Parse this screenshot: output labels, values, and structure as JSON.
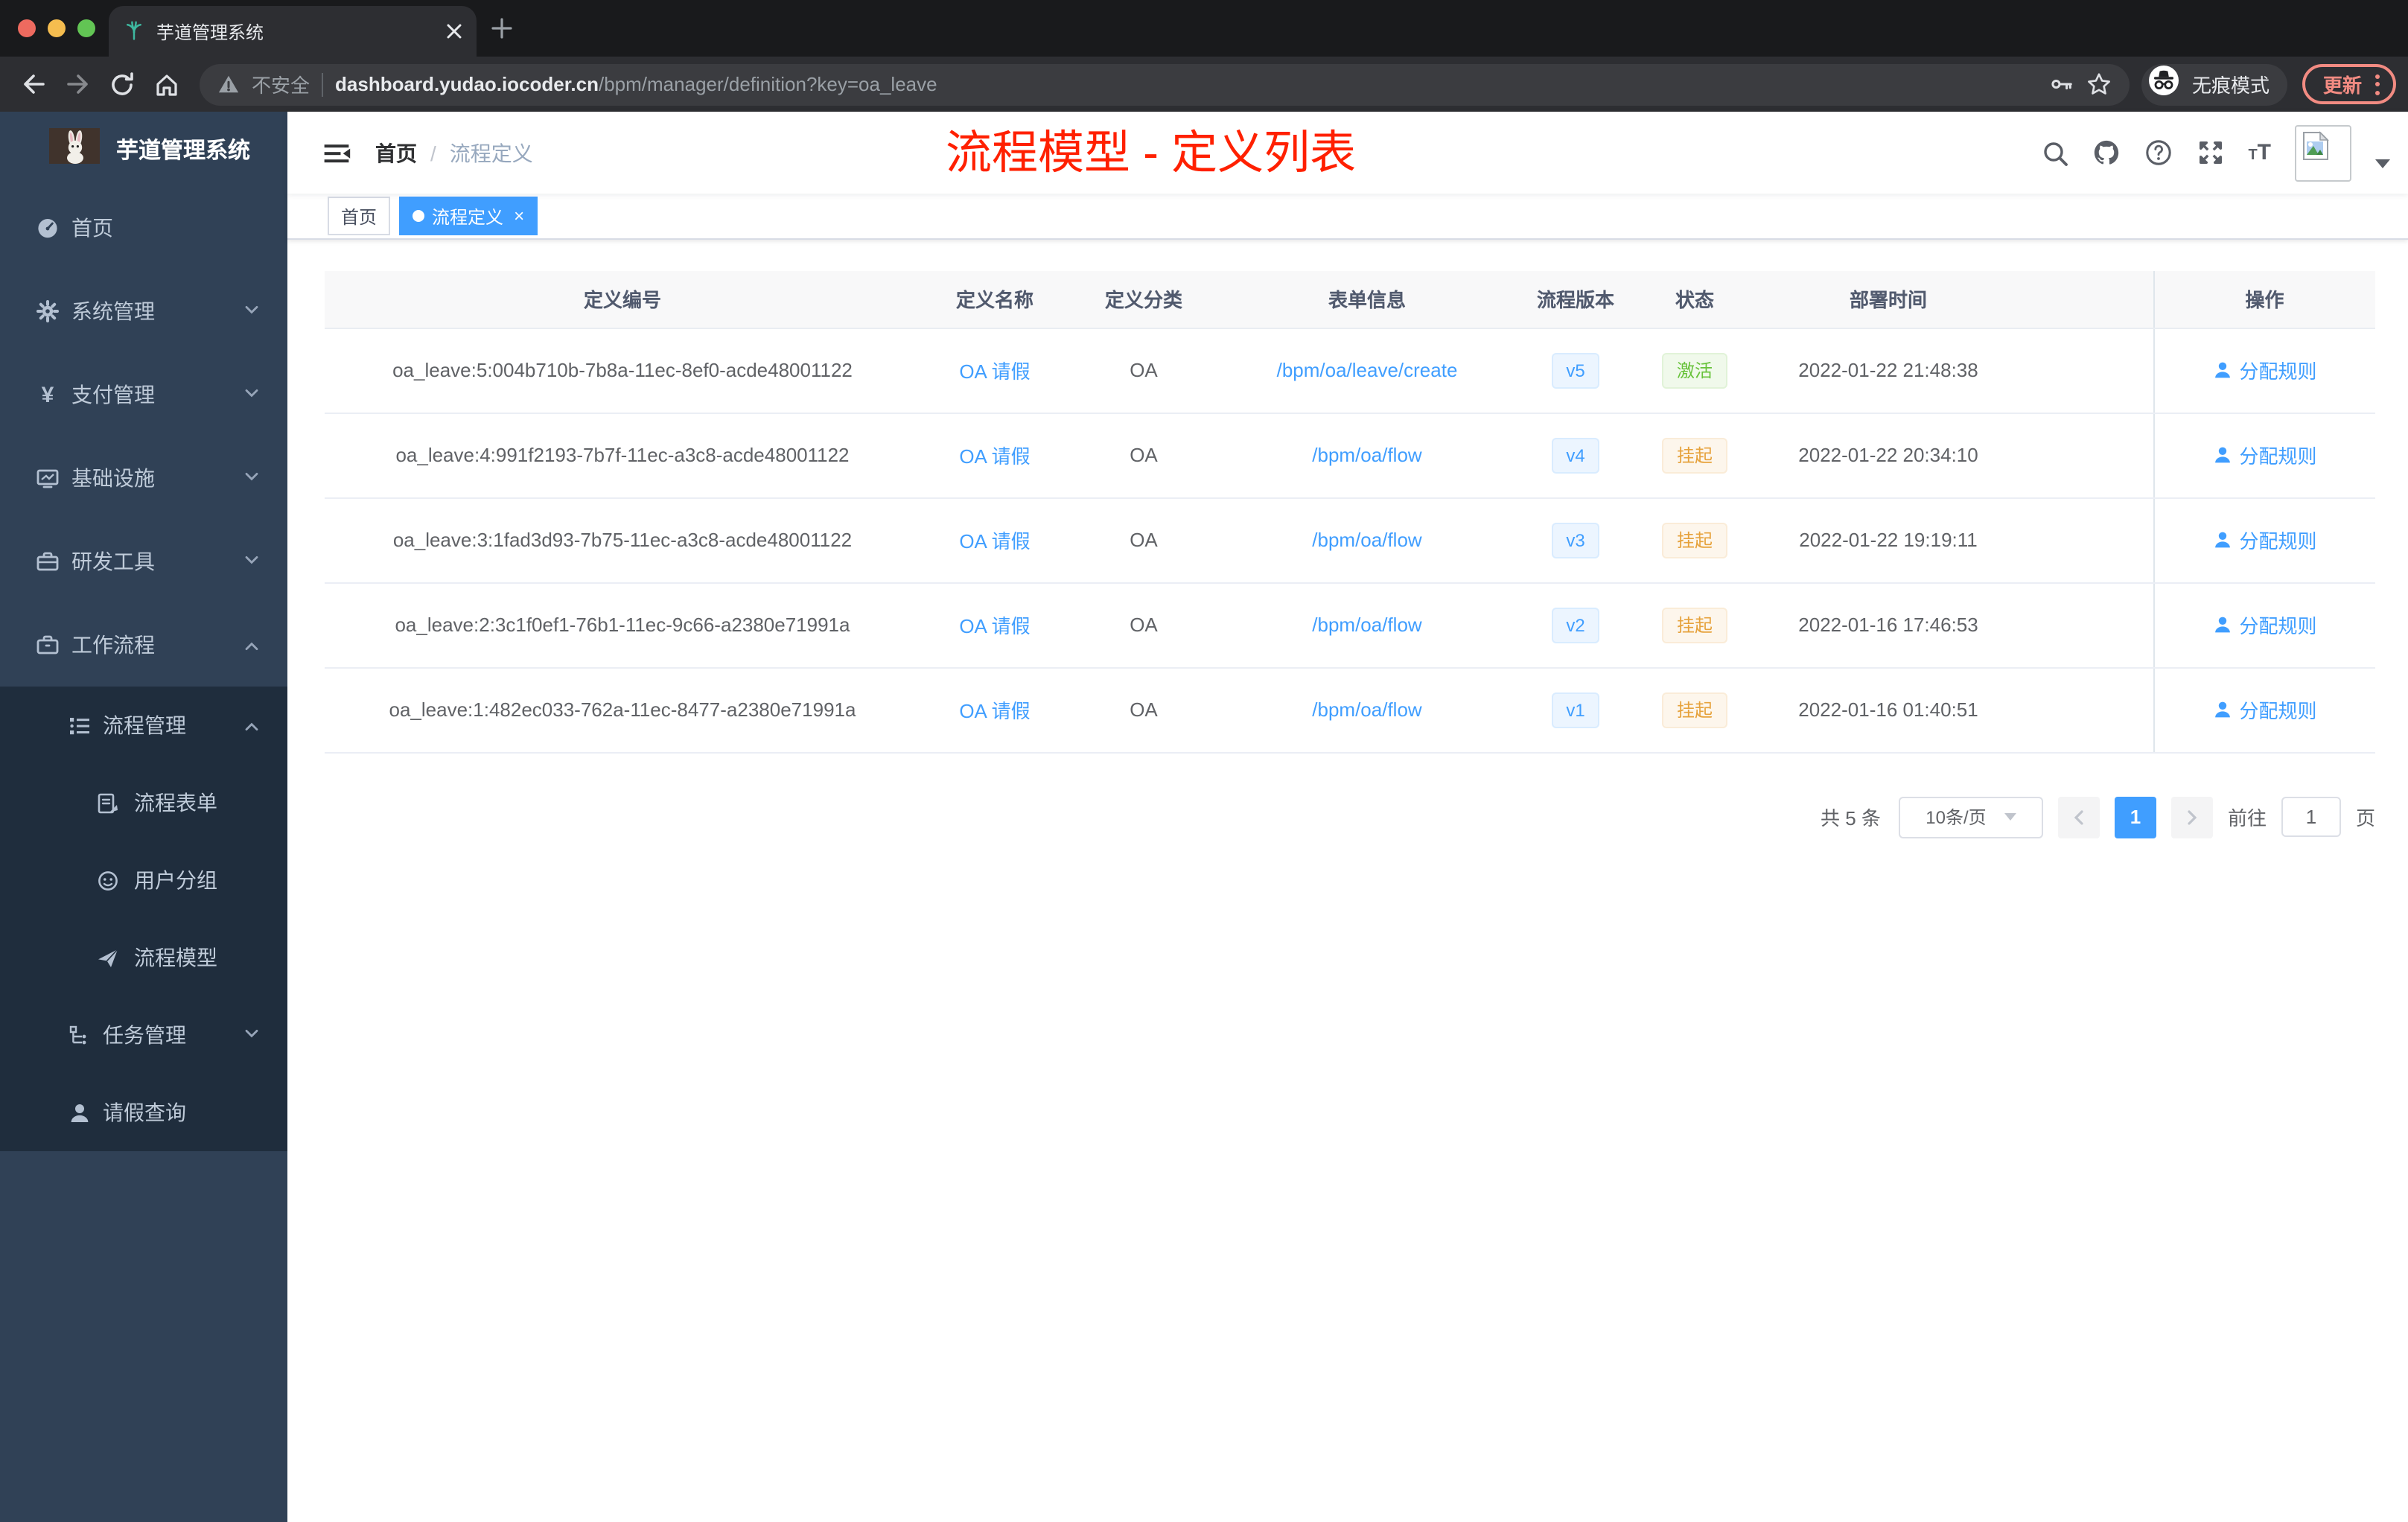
{
  "colors": {
    "accent": "#409eff",
    "success": "#67c23a",
    "warning": "#e6a23c",
    "annotation_red": "#ff2000",
    "update_pill": "#f28b82"
  },
  "browser": {
    "tab_title": "芋道管理系统",
    "not_secure": "不安全",
    "url_host": "dashboard.yudao.iocoder.cn",
    "url_path": "/bpm/manager/definition?key=oa_leave",
    "incognito_label": "无痕模式",
    "update_label": "更新"
  },
  "sidebar": {
    "logo_title": "芋道管理系统",
    "menu": {
      "home": "首页",
      "system": "系统管理",
      "pay": "支付管理",
      "infra": "基础设施",
      "dev": "研发工具",
      "workflow": "工作流程",
      "process_mgmt": "流程管理",
      "process_form": "流程表单",
      "user_group": "用户分组",
      "process_model": "流程模型",
      "task_mgmt": "任务管理",
      "leave_query": "请假查询"
    }
  },
  "header": {
    "breadcrumb_home": "首页",
    "breadcrumb_sep": "/",
    "breadcrumb_current": "流程定义",
    "annotation": "流程模型 - 定义列表"
  },
  "tags": {
    "home": "首页",
    "active": "流程定义",
    "close": "×"
  },
  "table": {
    "columns": [
      "定义编号",
      "定义名称",
      "定义分类",
      "表单信息",
      "流程版本",
      "状态",
      "部署时间",
      "操作"
    ],
    "action_label": "分配规则",
    "rows": [
      {
        "id": "oa_leave:5:004b710b-7b8a-11ec-8ef0-acde48001122",
        "name": "OA 请假",
        "category": "OA",
        "form": "/bpm/oa/leave/create",
        "version": "v5",
        "status": "激活",
        "time": "2022-01-22 21:48:38"
      },
      {
        "id": "oa_leave:4:991f2193-7b7f-11ec-a3c8-acde48001122",
        "name": "OA 请假",
        "category": "OA",
        "form": "/bpm/oa/flow",
        "version": "v4",
        "status": "挂起",
        "time": "2022-01-22 20:34:10"
      },
      {
        "id": "oa_leave:3:1fad3d93-7b75-11ec-a3c8-acde48001122",
        "name": "OA 请假",
        "category": "OA",
        "form": "/bpm/oa/flow",
        "version": "v3",
        "status": "挂起",
        "time": "2022-01-22 19:19:11"
      },
      {
        "id": "oa_leave:2:3c1f0ef1-76b1-11ec-9c66-a2380e71991a",
        "name": "OA 请假",
        "category": "OA",
        "form": "/bpm/oa/flow",
        "version": "v2",
        "status": "挂起",
        "time": "2022-01-16 17:46:53"
      },
      {
        "id": "oa_leave:1:482ec033-762a-11ec-8477-a2380e71991a",
        "name": "OA 请假",
        "category": "OA",
        "form": "/bpm/oa/flow",
        "version": "v1",
        "status": "挂起",
        "time": "2022-01-16 01:40:51"
      }
    ]
  },
  "pagination": {
    "total": "共 5 条",
    "page_size": "10条/页",
    "current_page": "1",
    "goto": "前往",
    "goto_value": "1",
    "unit": "页"
  }
}
